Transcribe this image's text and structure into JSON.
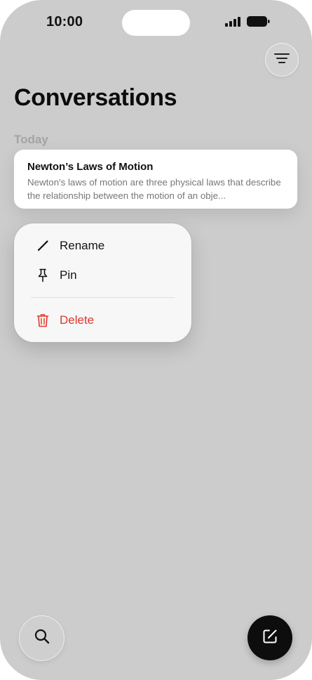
{
  "status_bar": {
    "time": "10:00",
    "icons": [
      "signal-icon",
      "battery-icon"
    ]
  },
  "header": {
    "title": "Conversations",
    "filter_icon": "filter-lines-icon"
  },
  "sections": [
    {
      "label": "Today",
      "conversations": [
        {
          "title": "Newton’s Laws of Motion",
          "preview": "Newton's laws of motion are three physical laws that describe the relationship between the motion of an obje..."
        }
      ]
    }
  ],
  "context_menu": {
    "items": [
      {
        "label": "Rename",
        "icon": "pencil-icon"
      },
      {
        "label": "Pin",
        "icon": "pin-icon"
      },
      {
        "label": "Delete",
        "icon": "trash-icon",
        "color": "#e0362c"
      }
    ]
  },
  "bottom_bar": {
    "search_icon": "search-icon",
    "compose_icon": "compose-icon"
  },
  "colors": {
    "background_dimmed": "#cccccc",
    "destructive": "#e0362c",
    "compose_button": "#0d0d0d"
  }
}
